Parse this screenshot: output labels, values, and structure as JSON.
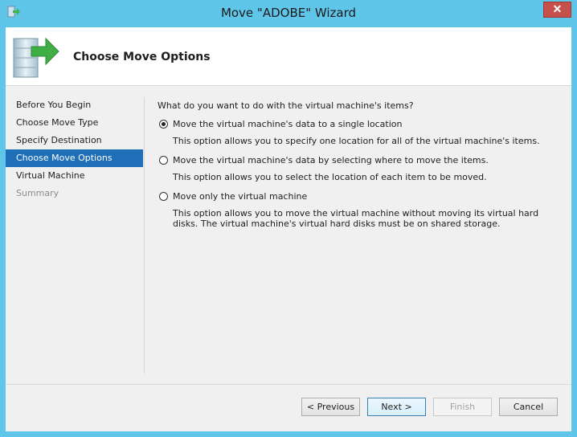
{
  "window": {
    "title": "Move \"ADOBE\" Wizard",
    "close_label": "✕"
  },
  "header": {
    "page_title": "Choose Move Options"
  },
  "nav": {
    "items": [
      {
        "label": "Before You Begin",
        "state": "normal"
      },
      {
        "label": "Choose Move Type",
        "state": "normal"
      },
      {
        "label": "Specify Destination",
        "state": "normal"
      },
      {
        "label": "Choose Move Options",
        "state": "active"
      },
      {
        "label": "Virtual Machine",
        "state": "normal"
      },
      {
        "label": "Summary",
        "state": "disabled"
      }
    ]
  },
  "content": {
    "question": "What do you want to do with the virtual machine's items?",
    "options": [
      {
        "label": "Move the virtual machine's data to a single location",
        "description": "This option allows you to specify one location for all of the virtual machine's items.",
        "checked": true
      },
      {
        "label": "Move the virtual machine's data by selecting where to move the items.",
        "description": "This option allows you to select the location of each item to be moved.",
        "checked": false
      },
      {
        "label": "Move only the virtual machine",
        "description": "This option allows you to move the virtual machine without moving its virtual hard disks. The virtual machine's virtual hard disks must be on shared storage.",
        "checked": false
      }
    ]
  },
  "buttons": {
    "previous": "< Previous",
    "next": "Next >",
    "finish": "Finish",
    "cancel": "Cancel"
  },
  "colors": {
    "frame": "#5fc6ea",
    "selection": "#1e6fb8",
    "close": "#c7504c"
  }
}
